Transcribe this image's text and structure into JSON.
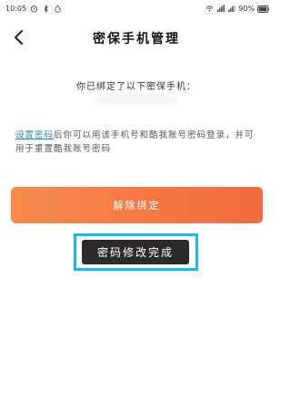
{
  "status_bar": {
    "time": "10:05",
    "battery": "90%"
  },
  "header": {
    "title": "密保手机管理"
  },
  "main": {
    "bound_text": "你已绑定了以下密保手机：",
    "notice_link": "设置密码",
    "notice_text": "后你可以用该手机号和酷我账号密码登录，并可用于重置酷我账号密码",
    "unbind_label": "解除绑定"
  },
  "toast": {
    "text": "密码修改完成"
  },
  "colors": {
    "accent_start": "#f78a4d",
    "accent_end": "#f36a3e",
    "link": "#2a8ab0",
    "highlight": "#19b8ea",
    "toast_bg": "#2b2b2b"
  }
}
